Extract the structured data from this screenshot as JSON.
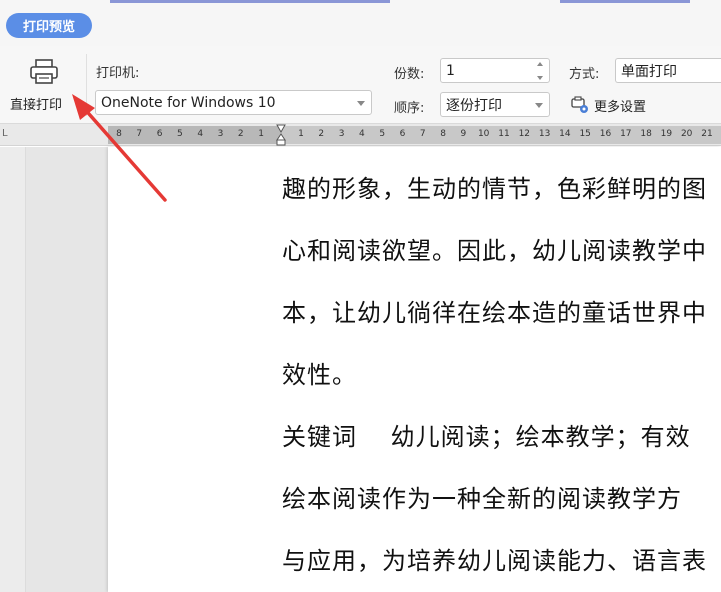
{
  "tab": {
    "label": "打印预览"
  },
  "toolbar": {
    "direct_print_label": "直接打印",
    "printer_label": "打印机:",
    "printer_value": "OneNote for Windows 10",
    "copies_label": "份数:",
    "copies_value": "1",
    "order_label": "顺序:",
    "order_value": "逐份打印",
    "mode_label": "方式:",
    "mode_value": "单面打印",
    "more_settings_label": "更多设置"
  },
  "ruler": {
    "left_numbers": [
      "8",
      "7",
      "6",
      "5",
      "4",
      "3",
      "2",
      "1"
    ],
    "right_numbers": [
      "1",
      "2",
      "3",
      "4",
      "5",
      "6",
      "7",
      "8",
      "9",
      "10",
      "11",
      "12",
      "13",
      "14",
      "15",
      "16",
      "17",
      "18",
      "19",
      "20",
      "21"
    ]
  },
  "document": {
    "lines": [
      "趣的形象，生动的情节，色彩鲜明的图",
      "心和阅读欲望。因此，幼儿阅读教学中",
      "本，让幼儿徜徉在绘本造的童话世界中",
      "效性。",
      "关键词　 幼儿阅读；绘本教学；有效",
      "绘本阅读作为一种全新的阅读教学方",
      "与应用，为培养幼儿阅读能力、语言表"
    ]
  },
  "colors": {
    "accent": "#5b8ee6",
    "annotation_arrow": "#e53935"
  }
}
